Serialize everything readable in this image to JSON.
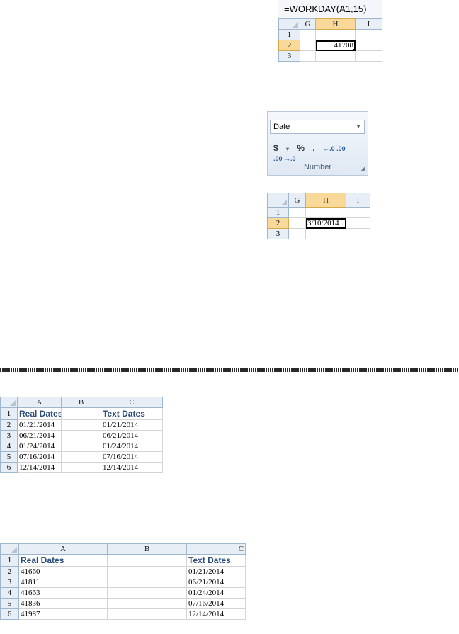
{
  "formula_bar": {
    "text": "=WORKDAY(A1,15)"
  },
  "grid1": {
    "cols": [
      "G",
      "H",
      "I"
    ],
    "rows": [
      "1",
      "2",
      "3"
    ],
    "active_value": "41708"
  },
  "ribbon": {
    "format_value": "Date",
    "buttons": [
      "$",
      "▾",
      "%",
      ",",
      "←.0 .00",
      ".00 →.0"
    ],
    "group_label": "Number"
  },
  "grid2": {
    "cols": [
      "G",
      "H",
      "I"
    ],
    "rows": [
      "1",
      "2",
      "3"
    ],
    "active_value": "3/10/2014"
  },
  "table1": {
    "cols": [
      "A",
      "B",
      "C"
    ],
    "row_nums": [
      "1",
      "2",
      "3",
      "4",
      "5",
      "6"
    ],
    "header": {
      "a": "Real Dates",
      "c": "Text Dates"
    },
    "rows": [
      {
        "a": "01/21/2014",
        "c": "01/21/2014"
      },
      {
        "a": "06/21/2014",
        "c": "06/21/2014"
      },
      {
        "a": "01/24/2014",
        "c": "01/24/2014"
      },
      {
        "a": "07/16/2014",
        "c": "07/16/2014"
      },
      {
        "a": "12/14/2014",
        "c": "12/14/2014"
      }
    ]
  },
  "table2": {
    "cols": [
      "A",
      "B",
      "C"
    ],
    "row_nums": [
      "1",
      "2",
      "3",
      "4",
      "5",
      "6"
    ],
    "header": {
      "a": "Real Dates",
      "c": "Text Dates"
    },
    "rows": [
      {
        "a": "41660",
        "c": "01/21/2014"
      },
      {
        "a": "41811",
        "c": "06/21/2014"
      },
      {
        "a": "41663",
        "c": "01/24/2014"
      },
      {
        "a": "41836",
        "c": "07/16/2014"
      },
      {
        "a": "41987",
        "c": "12/14/2014"
      }
    ]
  }
}
